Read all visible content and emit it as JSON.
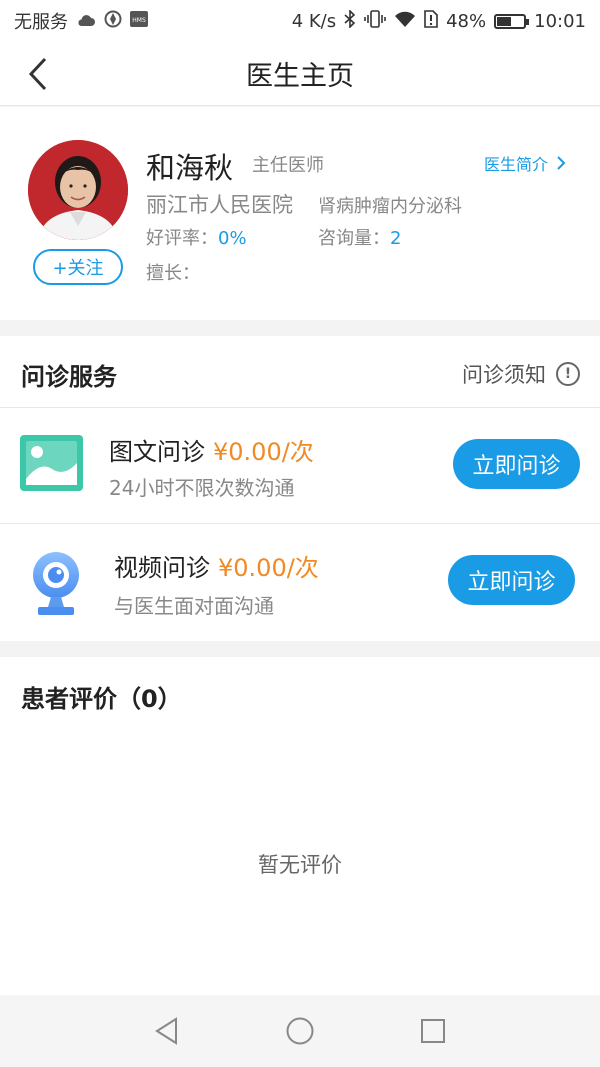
{
  "status_bar": {
    "carrier": "无服务",
    "speed": "4 K/s",
    "battery": "48%",
    "battery_level": 0.48,
    "time": "10:01"
  },
  "header": {
    "title": "医生主页",
    "back_icon": "chevron-left-icon"
  },
  "doctor": {
    "name": "和海秋",
    "title": "主任医师",
    "intro_link": "医生简介",
    "hospital": "丽江市人民医院",
    "department": "肾病肿瘤内分泌科",
    "rating_label": "好评率：",
    "rating_value": "0%",
    "consult_count_label": "咨询量：",
    "consult_count_value": "2",
    "specialty_label": "擅长：",
    "follow_label": "+关注"
  },
  "services": {
    "title": "问诊服务",
    "notice_label": "问诊须知",
    "items": [
      {
        "name": "图文问诊",
        "price": "¥0.00/次",
        "desc": "24小时不限次数沟通",
        "button": "立即问诊",
        "icon": "image-icon"
      },
      {
        "name": "视频问诊",
        "price": "¥0.00/次",
        "desc": "与医生面对面沟通",
        "button": "立即问诊",
        "icon": "webcam-icon"
      }
    ]
  },
  "reviews": {
    "title": "患者评价（0）",
    "empty_text": "暂无评价"
  },
  "colors": {
    "accent": "#1a9be6",
    "price": "#f08a24",
    "image_icon": "#3cc8a8",
    "video_icon": "#5b9cf0"
  }
}
